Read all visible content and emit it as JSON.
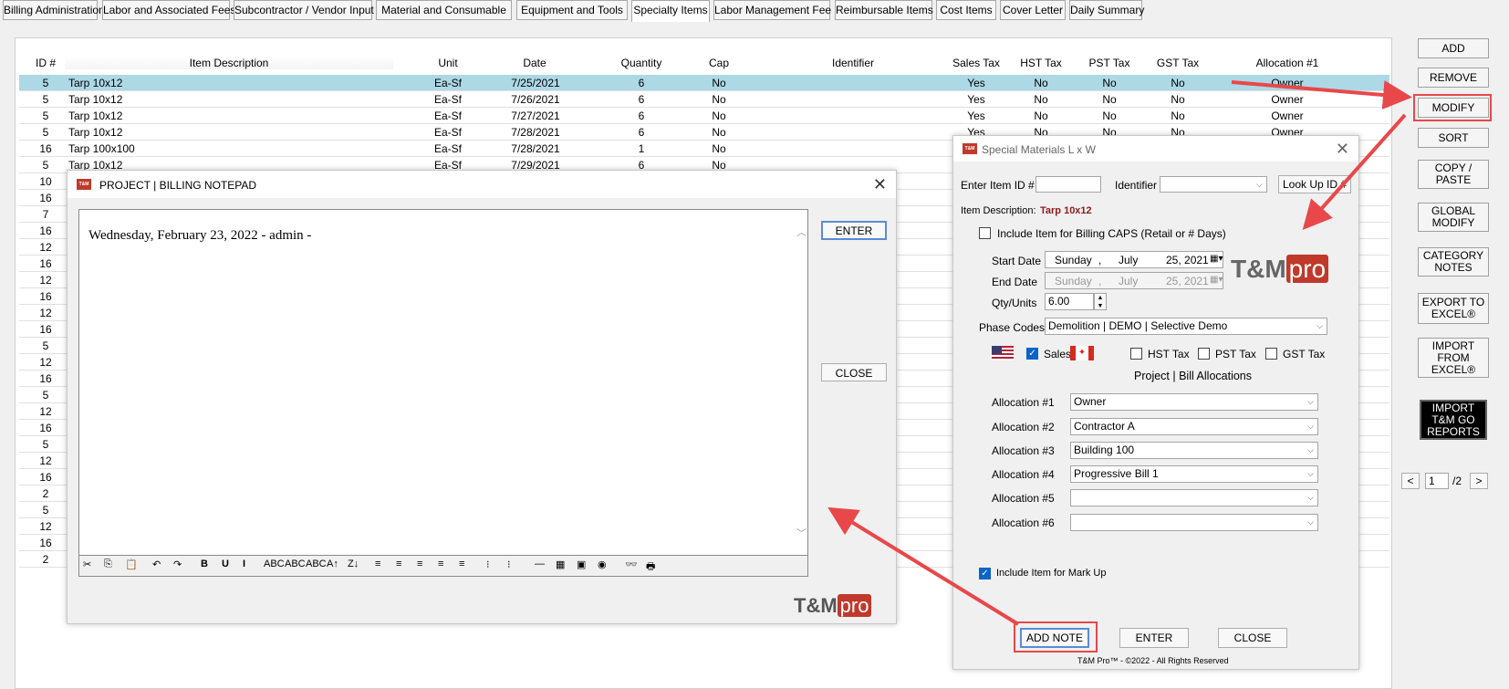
{
  "tabs": [
    "Billing Administration",
    "Labor and Associated Fees",
    "Subcontractor / Vendor Input",
    "Material and Consumable",
    "Equipment and Tools",
    "Specialty Items",
    "Labor Management Fee",
    "Reimbursable Items",
    "Cost Items",
    "Cover Letter",
    "Daily Summary"
  ],
  "active_tab": "Specialty Items",
  "grid": {
    "headers": [
      "ID #",
      "Item Description",
      "Unit",
      "Date",
      "Quantity",
      "Cap",
      "Identifier",
      "Sales Tax",
      "HST Tax",
      "PST Tax",
      "GST Tax",
      "Allocation #1"
    ],
    "rows": [
      {
        "id": "5",
        "desc": "Tarp 10x12",
        "unit": "Ea-Sf",
        "date": "7/25/2021",
        "qty": "6",
        "cap": "No",
        "sales": "Yes",
        "hst": "No",
        "pst": "No",
        "gst": "No",
        "alloc": "Owner"
      },
      {
        "id": "5",
        "desc": "Tarp 10x12",
        "unit": "Ea-Sf",
        "date": "7/26/2021",
        "qty": "6",
        "cap": "No",
        "sales": "Yes",
        "hst": "No",
        "pst": "No",
        "gst": "No",
        "alloc": "Owner"
      },
      {
        "id": "5",
        "desc": "Tarp 10x12",
        "unit": "Ea-Sf",
        "date": "7/27/2021",
        "qty": "6",
        "cap": "No",
        "sales": "Yes",
        "hst": "No",
        "pst": "No",
        "gst": "No",
        "alloc": "Owner"
      },
      {
        "id": "5",
        "desc": "Tarp 10x12",
        "unit": "Ea-Sf",
        "date": "7/28/2021",
        "qty": "6",
        "cap": "No",
        "sales": "Yes",
        "hst": "No",
        "pst": "No",
        "gst": "No",
        "alloc": "Owner"
      },
      {
        "id": "16",
        "desc": "Tarp 100x100",
        "unit": "Ea-Sf",
        "date": "7/28/2021",
        "qty": "1",
        "cap": "No",
        "sales": "",
        "hst": "",
        "pst": "",
        "gst": "",
        "alloc": ""
      },
      {
        "id": "5",
        "desc": "Tarp 10x12",
        "unit": "Ea-Sf",
        "date": "7/29/2021",
        "qty": "6",
        "cap": "No",
        "sales": "",
        "hst": "",
        "pst": "",
        "gst": "",
        "alloc": ""
      }
    ],
    "more_ids": [
      "10",
      "16",
      "7",
      "16",
      "12",
      "16",
      "12",
      "16",
      "12",
      "16",
      "5",
      "12",
      "16",
      "5",
      "12",
      "16",
      "5",
      "12",
      "16",
      "2",
      "5",
      "12",
      "16",
      "2"
    ]
  },
  "side_buttons": [
    "ADD",
    "REMOVE",
    "MODIFY",
    "SORT",
    "COPY /\nPASTE",
    "GLOBAL\nMODIFY",
    "CATEGORY\nNOTES",
    "EXPORT TO\nEXCEL®",
    "IMPORT\nFROM\nEXCEL®",
    "IMPORT\nT&M GO\nREPORTS"
  ],
  "pager": {
    "prev": "<",
    "page": "1",
    "total": "/2",
    "next": ">"
  },
  "notepad": {
    "title": "PROJECT | BILLING NOTEPAD",
    "text": "Wednesday, February 23, 2022 - admin -",
    "enter": "ENTER",
    "close": "CLOSE",
    "toolbar": [
      "✂",
      "⎘",
      "📋",
      "↶",
      "↷",
      "B",
      "U",
      "I",
      "ABC",
      "ABC",
      "ABC",
      "A↑",
      "Z↓",
      "≡",
      "≡",
      "≡",
      "≡",
      "≡",
      "⁝",
      "⁝",
      "—",
      "▦",
      "▣",
      "◉",
      "👓",
      "🖶"
    ]
  },
  "special": {
    "title": "Special Materials L x W",
    "enter_item_id_label": "Enter Item ID #",
    "enter_item_id_value": "",
    "identifier_label": "Identifier",
    "identifier_value": "",
    "lookup_button": "Look Up ID #",
    "item_description_label": "Item Description:",
    "item_description_value": "Tarp 10x12",
    "include_caps_label": "Include Item for Billing CAPS (Retail or # Days)",
    "start_date_label": "Start Date",
    "start_date_day": "Sunday",
    "start_date_month": "July",
    "start_date_rest": "25, 2021",
    "end_date_label": "End Date",
    "end_date_day": "Sunday",
    "end_date_month": "July",
    "end_date_rest": "25, 2021",
    "qty_label": "Qty/Units",
    "qty_value": "6.00",
    "phase_label": "Phase Codes",
    "phase_value": "Demolition | DEMO | Selective Demo",
    "sales_tax": "Sales Tax",
    "hst_tax": "HST Tax",
    "pst_tax": "PST Tax",
    "gst_tax": "GST Tax",
    "alloc_heading": "Project | Bill Allocations",
    "allocations": [
      {
        "label": "Allocation #1",
        "value": "Owner"
      },
      {
        "label": "Allocation #2",
        "value": "Contractor A"
      },
      {
        "label": "Allocation #3",
        "value": "Building 100"
      },
      {
        "label": "Allocation #4",
        "value": "Progressive Bill 1"
      },
      {
        "label": "Allocation #5",
        "value": ""
      },
      {
        "label": "Allocation #6",
        "value": ""
      }
    ],
    "markup_label": "Include Item for Mark Up",
    "add_note": "ADD NOTE",
    "enter": "ENTER",
    "close": "CLOSE",
    "footer": "T&M Pro™ - ©2022 - All Rights Reserved"
  },
  "logo": {
    "tm": "T&M",
    "pro": "pro"
  },
  "colors": {
    "selected_row": "#add8e6",
    "annotation": "#e8484a",
    "brand": "#c0392b",
    "desc_red": "#8b1a1a"
  }
}
